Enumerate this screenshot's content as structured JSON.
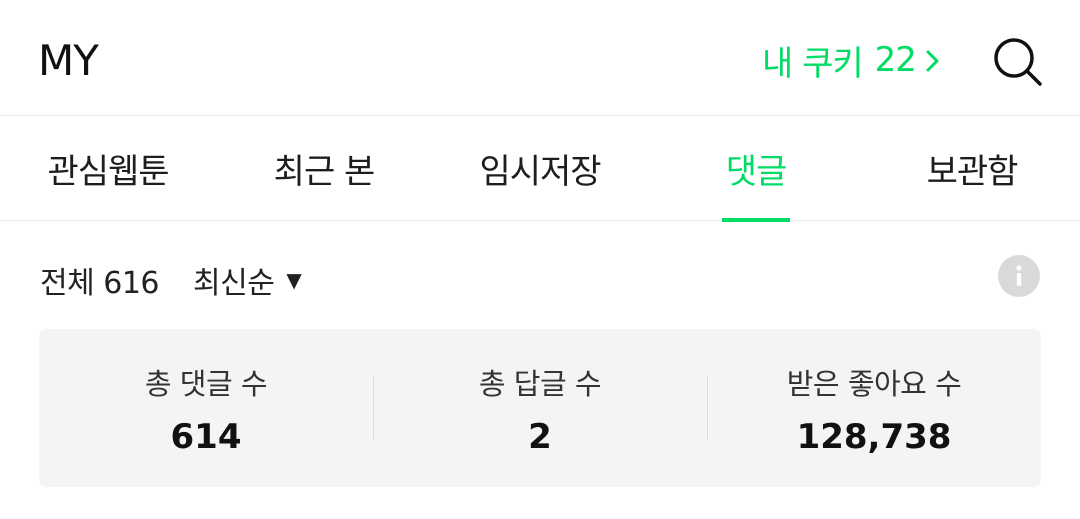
{
  "header": {
    "title": "MY",
    "cookie_label": "내 쿠키",
    "cookie_count": "22",
    "search_icon": "search-icon"
  },
  "tabs": [
    {
      "label": "관심웹툰",
      "active": false
    },
    {
      "label": "최근 본",
      "active": false
    },
    {
      "label": "임시저장",
      "active": false
    },
    {
      "label": "댓글",
      "active": true
    },
    {
      "label": "보관함",
      "active": false
    }
  ],
  "filter": {
    "total": "전체 616",
    "sort": "최신순",
    "info_icon": "info-icon"
  },
  "stats": [
    {
      "label": "총 댓글 수",
      "value": "614"
    },
    {
      "label": "총 답글 수",
      "value": "2"
    },
    {
      "label": "받은 좋아요 수",
      "value": "128,738"
    }
  ],
  "colors": {
    "accent": "#00dc64",
    "panel": "#f4f4f4",
    "info_bg": "#d9d9d9"
  }
}
